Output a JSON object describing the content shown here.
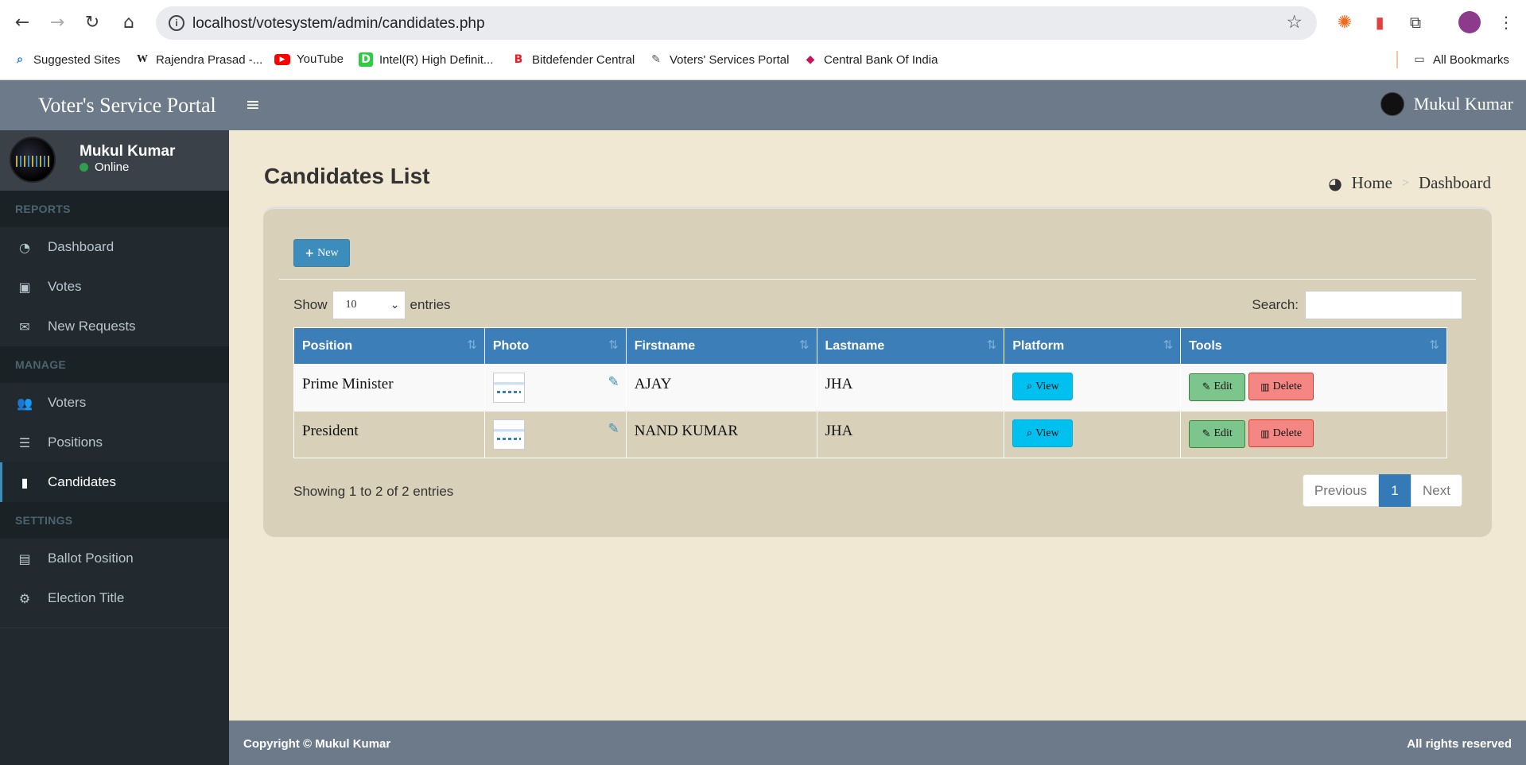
{
  "browser": {
    "url": "localhost/votesystem/admin/candidates.php",
    "bookmarks": [
      {
        "label": "Suggested Sites",
        "icon": "search-icon",
        "color": "#1a73e8",
        "glyph": "🔍"
      },
      {
        "label": "Rajendra Prasad -...",
        "icon": "wikipedia-icon",
        "color": "#000000",
        "glyph": "W"
      },
      {
        "label": "YouTube",
        "icon": "youtube-icon",
        "color": "#ff0000",
        "glyph": "▶"
      },
      {
        "label": "Intel(R) High Definit...",
        "icon": "intel-icon",
        "color": "#2ecc40",
        "glyph": "D"
      },
      {
        "label": "Bitdefender Central",
        "icon": "bitdefender-icon",
        "color": "#ed1c24",
        "glyph": "B"
      },
      {
        "label": "Voters' Services Portal",
        "icon": "voters-portal-icon",
        "color": "#555555",
        "glyph": "✎"
      },
      {
        "label": "Central Bank Of India",
        "icon": "central-bank-icon",
        "color": "#c2185b",
        "glyph": "◆"
      }
    ],
    "all_bookmarks": "All Bookmarks"
  },
  "header": {
    "logo": "Voter's Service Portal",
    "user": "Mukul Kumar"
  },
  "sidebar": {
    "user": {
      "name": "Mukul Kumar",
      "status": "Online"
    },
    "sections": {
      "reports": "REPORTS",
      "manage": "MANAGE",
      "settings": "SETTINGS"
    },
    "items": [
      {
        "label": "Dashboard",
        "icon": "dashboard-icon"
      },
      {
        "label": "Votes",
        "icon": "lock-icon"
      },
      {
        "label": "New Requests",
        "icon": "envelope-icon"
      },
      {
        "label": "Voters",
        "icon": "users-icon"
      },
      {
        "label": "Positions",
        "icon": "list-icon"
      },
      {
        "label": "Candidates",
        "icon": "id-badge-icon"
      },
      {
        "label": "Ballot Position",
        "icon": "file-icon"
      },
      {
        "label": "Election Title",
        "icon": "cogs-icon"
      }
    ]
  },
  "page": {
    "title": "Candidates List",
    "breadcrumb": {
      "home": "Home",
      "current": "Dashboard"
    }
  },
  "box": {
    "new_button": "New",
    "show_label": "Show",
    "entries_value": "10",
    "entries_label": "entries",
    "search_label": "Search:",
    "search_value": ""
  },
  "table": {
    "columns": [
      "Position",
      "Photo",
      "Firstname",
      "Lastname",
      "Platform",
      "Tools"
    ],
    "rows": [
      {
        "position": "Prime Minister",
        "firstname": "AJAY",
        "lastname": "JHA"
      },
      {
        "position": "President",
        "firstname": "NAND KUMAR",
        "lastname": "JHA"
      }
    ],
    "view_label": "View",
    "edit_label": "Edit",
    "delete_label": "Delete"
  },
  "pagination": {
    "info": "Showing 1 to 2 of 2 entries",
    "previous": "Previous",
    "current": "1",
    "next": "Next"
  },
  "footer": {
    "copyright": "Copyright © Mukul Kumar",
    "rights": "All rights reserved"
  },
  "colors": {
    "header": "#6c7a89",
    "sidebar": "#22292f",
    "content_bg": "#f0e8d2",
    "table_header": "#3c7fb8",
    "view_button": "#00c0ef",
    "edit_button": "#7cc68e",
    "delete_button": "#f48784"
  }
}
